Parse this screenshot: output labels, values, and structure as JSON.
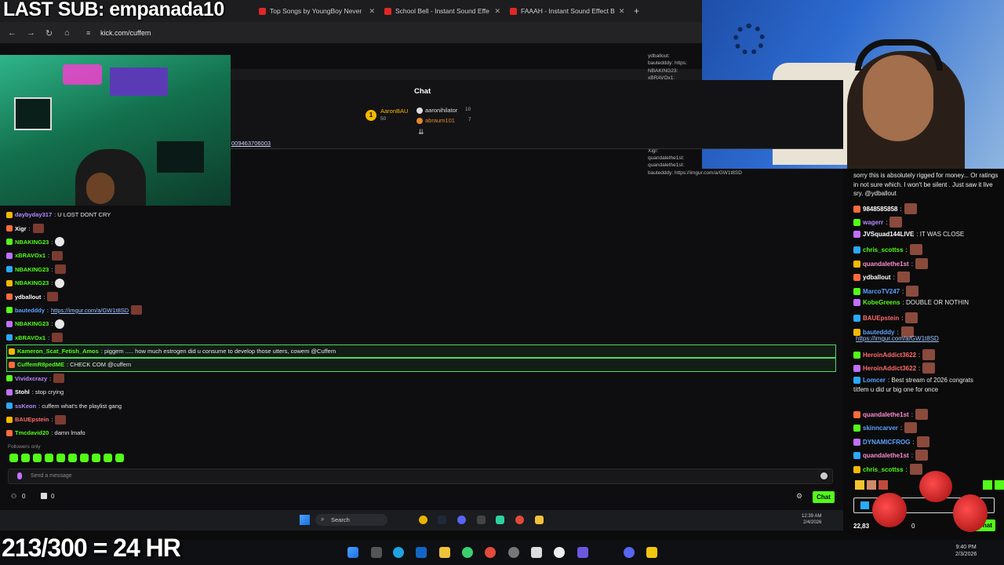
{
  "overlay": {
    "last_sub": "LAST SUB: empanada10",
    "goal": "213/300 = 24 HR"
  },
  "browser": {
    "tabs": [
      {
        "label": "Top Songs by YoungBoy Never"
      },
      {
        "label": "School Bell - Instant Sound Effe"
      },
      {
        "label": "FAAAH - Instant Sound Effect B"
      }
    ],
    "new_tab": "+",
    "url": "kick.com/cuffem"
  },
  "chat_panel": {
    "title": "Chat",
    "leaderboard": [
      {
        "name": "AaronBAU",
        "value": "50"
      },
      {
        "name": "aaronihilator",
        "value": "10"
      },
      {
        "name": "abraum101",
        "value": "7"
      }
    ],
    "link_fragment": "009463706003",
    "followers_only": "Followers only",
    "send_placeholder": "Send a message",
    "chat_button": "Chat",
    "stats_left": "0",
    "stats_right": "0"
  },
  "mini_chat": [
    "ydballout:",
    "bautedddy: https:",
    "NBAKING23:",
    "xBRAVOx1:",
    "Kameron_Scat_Fetish",
    "to develop those utter",
    "CuffemR8pedME:",
    "Vividxcrazy:",
    "Stohl: stop crying",
    "ssKeon: cuffem what'",
    "BAUEpstein:",
    "Tmcdavid20: damn",
    "daybyday317: U LOST",
    "Xigr:",
    "quandalethe1st:",
    "quandalethe1st:",
    "bautedddy: https://imgur.com/a/GW1t8SD"
  ],
  "chat_log": [
    {
      "user": "daybyday317",
      "text": ": U LOST DONT CRY",
      "color": "#b48bff"
    },
    {
      "user": "Xigr",
      "text": ":",
      "color": "#ffffff"
    },
    {
      "user": "NBAKING23",
      "text": ":",
      "color": "#53fc18"
    },
    {
      "user": "xBRAVOx1",
      "text": ":",
      "color": "#53fc18"
    },
    {
      "user": "NBAKING23",
      "text": ":",
      "color": "#53fc18"
    },
    {
      "user": "NBAKING23",
      "text": ":",
      "color": "#53fc18"
    },
    {
      "user": "ydballout",
      "text": ":",
      "color": "#ffffff"
    },
    {
      "user": "bautedddy",
      "text": ": ",
      "link": "https://imgur.com/a/GW1t8SD",
      "color": "#5aa2ff"
    },
    {
      "user": "NBAKING23",
      "text": ":",
      "color": "#53fc18"
    },
    {
      "user": "xBRAVOx1",
      "text": ":",
      "color": "#53fc18"
    },
    {
      "user": "Kameron_Scat_Fetish_Amos",
      "text": ": piggem ..... how much estrogen did u consume to develop those utters, cowem @Cuffem",
      "color": "#53fc18",
      "highlight": true
    },
    {
      "user": "CuffemR8pedME",
      "text": ": CHECK COM @cuffem",
      "color": "#53fc18",
      "highlight": true
    },
    {
      "user": "Vividxcrazy",
      "text": ":",
      "color": "#b48bff"
    },
    {
      "user": "Stohl",
      "text": ": stop crying",
      "color": "#ffffff"
    },
    {
      "user": "ssKeon",
      "text": ": cuffem what's the playlist gang",
      "color": "#b48bff"
    },
    {
      "user": "BAUEpstein",
      "text": ":",
      "color": "#ff6b6b"
    },
    {
      "user": "Tmcdavid20",
      "text": ": damn lmafo",
      "color": "#53fc18"
    }
  ],
  "right_chat": {
    "intro": "sorry this is absolutely rigged for money... Or ratings in not sure which. I won't be silent . Just saw it live sry. @ydballout",
    "messages": [
      {
        "user": "9848585858",
        "text": ":",
        "color": "#ffffff"
      },
      {
        "user": "wagerr",
        "text": ":",
        "color": "#b48bff"
      },
      {
        "user": "JVSquad144LIVE",
        "text": ": IT WAS CLOSE",
        "color": "#ffffff"
      },
      {
        "user": "chris_scottss",
        "text": ":",
        "color": "#53fc18"
      },
      {
        "user": "quandalethe1st",
        "text": ":",
        "color": "#ff8bd1"
      },
      {
        "user": "ydballout",
        "text": ":",
        "color": "#ffffff"
      },
      {
        "user": "MarcoTV247",
        "text": ":",
        "color": "#5aa2ff"
      },
      {
        "user": "KobeGreens",
        "text": ": DOUBLE OR NOTHIN",
        "color": "#53fc18"
      },
      {
        "user": "BAUEpstein",
        "text": ":",
        "color": "#ff6b6b"
      },
      {
        "user": "bautedddy",
        "text": ":",
        "color": "#5aa2ff"
      },
      {
        "user": "",
        "text": "",
        "link": "https://imgur.com/a/GW1t8SD",
        "color": "#ffffff"
      },
      {
        "user": "HeroinAddict3622",
        "text": ":",
        "color": "#ff6b6b"
      },
      {
        "user": "HeroinAddict3622",
        "text": ":",
        "color": "#ff6b6b"
      },
      {
        "user": "Lomcer",
        "text": ": Best stream of 2026 congrats",
        "color": "#5aa2ff"
      },
      {
        "user": "",
        "text": "titfem u did ur big one for once",
        "color": "#ffffff"
      },
      {
        "user": "quandalethe1st",
        "text": ":",
        "color": "#ff8bd1"
      },
      {
        "user": "skinncarver",
        "text": ":",
        "color": "#5aa2ff"
      },
      {
        "user": "DYNAMICFROG",
        "text": ":",
        "color": "#5aa2ff"
      },
      {
        "user": "quandalethe1st",
        "text": ":",
        "color": "#ff8bd1"
      },
      {
        "user": "chris_scottss",
        "text": ":",
        "color": "#53fc18"
      }
    ],
    "viewers": "22,83",
    "counter": "0",
    "chat_button": "Chat"
  },
  "inner_taskbar": {
    "search": "Search",
    "time": "12:39 AM",
    "date": "2/4/2026"
  },
  "outer_taskbar": {
    "time": "9:40 PM",
    "date": "2/3/2026"
  },
  "colors": {
    "kick_green": "#53fc18",
    "highlight_border": "#4cd964"
  }
}
